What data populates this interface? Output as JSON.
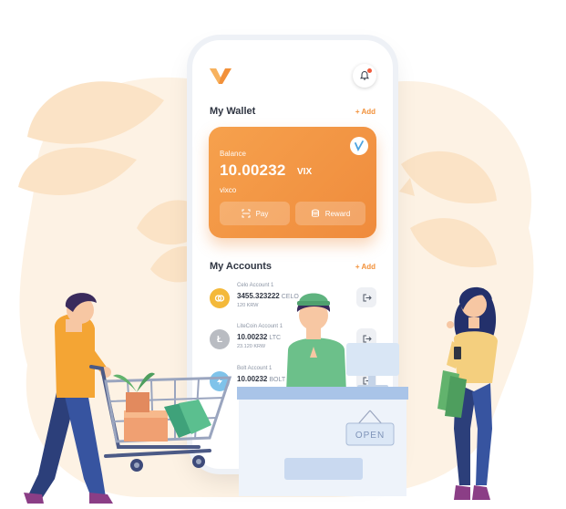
{
  "wallet": {
    "title": "My Wallet",
    "add_label": "+ Add",
    "balance_label": "Balance",
    "balance_value": "10.00232",
    "balance_unit": "VIX",
    "wallet_name": "vixco",
    "pay_label": "Pay",
    "reward_label": "Reward"
  },
  "accounts": {
    "title": "My Accounts",
    "add_label": "+ Add",
    "items": [
      {
        "name": "Celo Account 1",
        "amount": "3455.323222",
        "coin": "CELO",
        "fiat": "120 KRW",
        "color": "#f4b93a"
      },
      {
        "name": "LiteCoin Account 1",
        "amount": "10.00232",
        "coin": "LTC",
        "fiat": "23.120 KRW",
        "color": "#b9bcc2"
      },
      {
        "name": "Bolt Account 1",
        "amount": "10.00232",
        "coin": "BOLT",
        "fiat": "",
        "color": "#7fc3ea"
      }
    ]
  },
  "shop": {
    "sign_label": "OPEN"
  },
  "colors": {
    "accent": "#f2913a",
    "card_start": "#f6a14d",
    "card_end": "#ef8b3c",
    "bg_blob": "#fdf1e2"
  }
}
